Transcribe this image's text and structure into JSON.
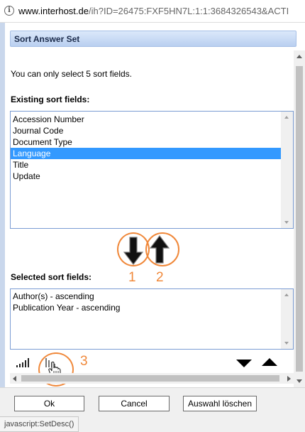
{
  "browser": {
    "url_host": "www.interhost.de",
    "url_rest": "/ih?ID=26475:FXF5HN7L:1:1:3684326543&ACTI"
  },
  "dialog": {
    "title": "Sort Answer Set",
    "info": "You can only select 5 sort fields."
  },
  "existing": {
    "label": "Existing sort fields:",
    "items": [
      "Accession Number",
      "Journal Code",
      "Document Type",
      "Language",
      "Title",
      "Update"
    ],
    "selected_index": 3
  },
  "selected": {
    "label": "Selected sort fields:",
    "items": [
      "Author(s) - ascending",
      "Publication Year - ascending"
    ]
  },
  "annotations": {
    "marker_1": "1",
    "marker_2": "2",
    "marker_3": "3",
    "color": "#f0883a"
  },
  "icons": {
    "move_down": "arrow-down-icon",
    "move_up": "arrow-up-icon",
    "sort_ascending": "ascending-bars-icon",
    "sort_descending": "descending-bars-icon",
    "cursor": "hand-cursor-icon",
    "move_item_down": "triangle-down-icon",
    "move_item_up": "triangle-up-icon"
  },
  "buttons": {
    "ok": "Ok",
    "cancel": "Cancel",
    "clear": "Auswahl löschen"
  },
  "status": {
    "text": "javascript:SetDesc()"
  },
  "colors": {
    "title_bar": "#c8d9f3",
    "selection": "#3399ff",
    "list_border": "#7a9cd3"
  }
}
